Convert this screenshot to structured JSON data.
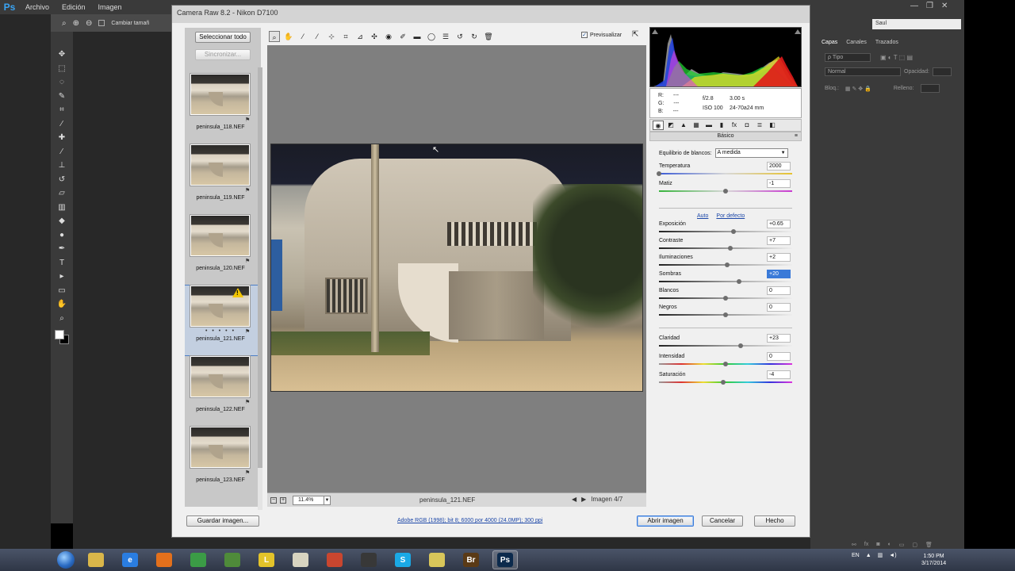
{
  "photoshop": {
    "logo": "Ps",
    "menu": [
      "Archivo",
      "Edición",
      "Imagen"
    ],
    "options": {
      "resize_label": "Cambiar tamañ"
    },
    "window_controls": [
      "—",
      "❐",
      "✕"
    ],
    "workspace": "Saul",
    "panel_tabs": [
      "Capas",
      "Canales",
      "Trazados"
    ],
    "layer_filter": "ρ Tipo",
    "blend_mode": "Normal",
    "opacity_label": "Opacidad:",
    "lock_label": "Bloq.:",
    "fill_label": "Relleno:",
    "tools": [
      "move-icon",
      "marquee-icon",
      "lasso-icon",
      "quick-select-icon",
      "crop-icon",
      "eyedropper-icon",
      "healing-icon",
      "brush-icon",
      "stamp-icon",
      "history-brush-icon",
      "eraser-icon",
      "gradient-icon",
      "blur-icon",
      "dodge-icon",
      "pen-icon",
      "type-icon",
      "path-select-icon",
      "shape-icon",
      "hand-icon",
      "zoom-icon"
    ]
  },
  "dialog": {
    "title": "Camera Raw 8.2 - Nikon D7100",
    "filmstrip": {
      "select_all": "Seleccionar todo",
      "sync": "Sincronizar...",
      "items": [
        {
          "name": "peninsula_118.NEF",
          "selected": false,
          "warning": false
        },
        {
          "name": "peninsula_119.NEF",
          "selected": false,
          "warning": false
        },
        {
          "name": "peninsula_120.NEF",
          "selected": false,
          "warning": false
        },
        {
          "name": "peninsula_121.NEF",
          "selected": true,
          "warning": true
        },
        {
          "name": "peninsula_122.NEF",
          "selected": false,
          "warning": false
        },
        {
          "name": "peninsula_123.NEF",
          "selected": false,
          "warning": false
        }
      ],
      "rating_dots": "• • • • •"
    },
    "tools": [
      "zoom-icon",
      "hand-icon",
      "white-balance-icon",
      "color-sampler-icon",
      "target-adjust-icon",
      "crop-icon",
      "straighten-icon",
      "spot-removal-icon",
      "red-eye-icon",
      "adjustment-brush-icon",
      "graduated-filter-icon",
      "radial-filter-icon",
      "preferences-icon",
      "rotate-left-icon",
      "rotate-right-icon",
      "trash-icon"
    ],
    "preview_label": "Previsualizar",
    "status": {
      "zoom": "11.4%",
      "filename": "peninsula_121.NEF",
      "image_counter": "Imagen 4/7"
    },
    "info": {
      "rgb": [
        [
          "R:",
          "---"
        ],
        [
          "G:",
          "---"
        ],
        [
          "B:",
          "---"
        ]
      ],
      "aperture": "f/2.8",
      "shutter": "3.00 s",
      "iso": "ISO 100",
      "lens": "24-70a24 mm"
    },
    "panel_tabs": [
      "basic-icon",
      "tone-curve-icon",
      "detail-icon",
      "hsl-icon",
      "split-toning-icon",
      "lens-icon",
      "effects-icon",
      "camera-calibration-icon",
      "presets-icon",
      "snapshots-icon"
    ],
    "panel_title": "Básico",
    "panel_menu": "≡",
    "basic": {
      "wb_label": "Equilibrio de blancos:",
      "wb_value": "A medida",
      "auto": "Auto",
      "default": "Por defecto",
      "sliders": [
        {
          "key": "temperatura",
          "label": "Temperatura",
          "value": "2000",
          "level": 0.0,
          "track": "temp"
        },
        {
          "key": "matiz",
          "label": "Matiz",
          "value": "-1",
          "level": 0.5,
          "track": "tint"
        },
        {
          "key": "exposicion",
          "label": "Exposición",
          "value": "+0.65",
          "level": 0.56,
          "track": "gray"
        },
        {
          "key": "contraste",
          "label": "Contraste",
          "value": "+7",
          "level": 0.535,
          "track": "gray"
        },
        {
          "key": "iluminaciones",
          "label": "Iluminaciones",
          "value": "+2",
          "level": 0.51,
          "track": "gray"
        },
        {
          "key": "sombras",
          "label": "Sombras",
          "value": "+20",
          "level": 0.6,
          "track": "gray",
          "highlight": true
        },
        {
          "key": "blancos",
          "label": "Blancos",
          "value": "0",
          "level": 0.5,
          "track": "gray"
        },
        {
          "key": "negros",
          "label": "Negros",
          "value": "0",
          "level": 0.5,
          "track": "gray"
        },
        {
          "key": "claridad",
          "label": "Claridad",
          "value": "+23",
          "level": 0.615,
          "track": "gray"
        },
        {
          "key": "intensidad",
          "label": "Intensidad",
          "value": "0",
          "level": 0.5,
          "track": "rainbow"
        },
        {
          "key": "saturacion",
          "label": "Saturación",
          "value": "-4",
          "level": 0.48,
          "track": "rainbow"
        }
      ]
    },
    "footer": {
      "save": "Guardar imagen...",
      "workflow": "Adobe RGB (1998); bit 8; 6000 por 4000 (24.0MP); 300 ppi",
      "open": "Abrir imagen",
      "cancel": "Cancelar",
      "done": "Hecho"
    }
  },
  "taskbar": {
    "apps": [
      {
        "name": "explorer",
        "label": "",
        "color": "#d9b64a"
      },
      {
        "name": "internet-explorer",
        "label": "e",
        "color": "#2a7de1"
      },
      {
        "name": "firefox",
        "label": "",
        "color": "#e3701c"
      },
      {
        "name": "chrome",
        "label": "",
        "color": "#3b9b46"
      },
      {
        "name": "app-green",
        "label": "",
        "color": "#4f8b3a"
      },
      {
        "name": "app-yellow",
        "label": "L",
        "color": "#e3c32a"
      },
      {
        "name": "app-diamond",
        "label": "",
        "color": "#d8d4c0"
      },
      {
        "name": "app-red",
        "label": "",
        "color": "#c9462f"
      },
      {
        "name": "app-camera",
        "label": "",
        "color": "#383838"
      },
      {
        "name": "skype",
        "label": "S",
        "color": "#1aa9e6"
      },
      {
        "name": "app-folder",
        "label": "",
        "color": "#d8c65a"
      },
      {
        "name": "bridge",
        "label": "Br",
        "color": "#5a3a16"
      },
      {
        "name": "photoshop",
        "label": "Ps",
        "color": "#0c2a4c"
      }
    ],
    "lang": "EN",
    "time": "1:50 PM",
    "date": "3/17/2014"
  }
}
